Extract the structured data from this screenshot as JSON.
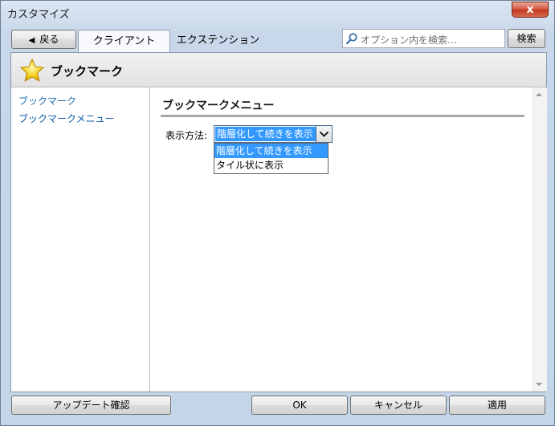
{
  "window": {
    "title": "カスタマイズ",
    "close_label": "x"
  },
  "toolbar": {
    "back_label": "戻る",
    "tabs": [
      {
        "label": "クライアント",
        "active": true
      },
      {
        "label": "エクステンション",
        "active": false
      }
    ],
    "search": {
      "placeholder": "オプション内を検索...",
      "value": "",
      "button_label": "検索"
    }
  },
  "page": {
    "icon": "star-icon",
    "title": "ブックマーク"
  },
  "sidebar": {
    "items": [
      {
        "label": "ブックマーク"
      },
      {
        "label": "ブックマークメニュー"
      }
    ]
  },
  "main": {
    "section_title": "ブックマークメニュー",
    "display_method": {
      "label": "表示方法:",
      "selected": "階層化して続きを表示",
      "options": [
        "階層化して続きを表示",
        "タイル状に表示"
      ]
    }
  },
  "footer": {
    "update_label": "アップデート確認",
    "ok_label": "OK",
    "cancel_label": "キャンセル",
    "apply_label": "適用"
  },
  "colors": {
    "accent": "#3399ff",
    "link": "#1f6fb4",
    "close_button": "#c23a1f"
  }
}
